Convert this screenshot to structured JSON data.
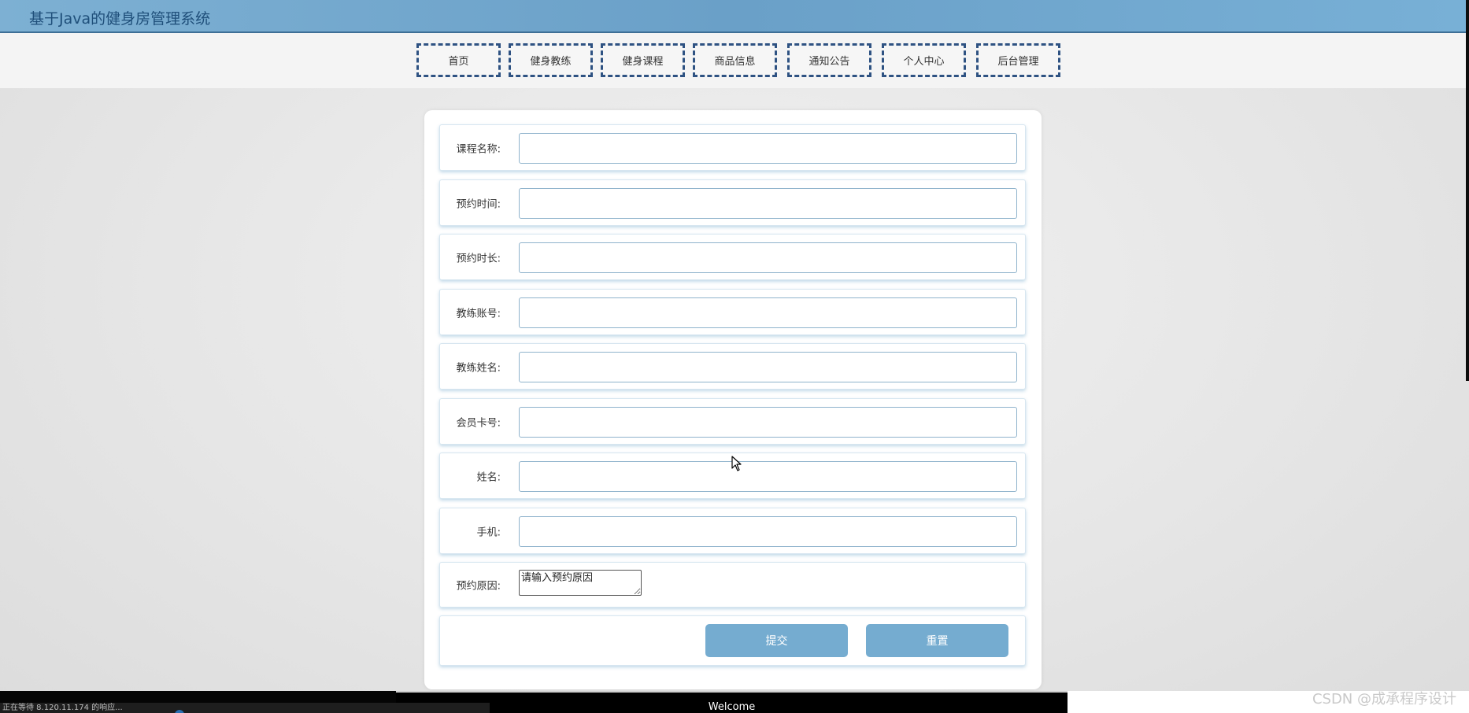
{
  "header": {
    "site_title": "基于Java的健身房管理系统"
  },
  "nav": {
    "items": [
      {
        "label": "首页"
      },
      {
        "label": "健身教练"
      },
      {
        "label": "健身课程"
      },
      {
        "label": "商品信息"
      },
      {
        "label": "通知公告"
      },
      {
        "label": "个人中心"
      },
      {
        "label": "后台管理"
      }
    ]
  },
  "form": {
    "fields": [
      {
        "label": "课程名称:",
        "value": ""
      },
      {
        "label": "预约时间:",
        "value": ""
      },
      {
        "label": "预约时长:",
        "value": ""
      },
      {
        "label": "教练账号:",
        "value": ""
      },
      {
        "label": "教练姓名:",
        "value": ""
      },
      {
        "label": "会员卡号:",
        "value": ""
      },
      {
        "label": "姓名:",
        "value": ""
      },
      {
        "label": "手机:",
        "value": ""
      }
    ],
    "reason": {
      "label": "预约原因:",
      "placeholder": "请输入预约原因"
    },
    "submit_label": "提交",
    "reset_label": "重置"
  },
  "footer": {
    "welcome": "Welcome",
    "status_text": "正在等待 8.120.11.174 的响应...",
    "watermark": "CSDN @成承程序设计"
  },
  "colors": {
    "header_bg": "#6aa0c8",
    "nav_border": "#2e5282",
    "button_bg": "#75acd0"
  }
}
